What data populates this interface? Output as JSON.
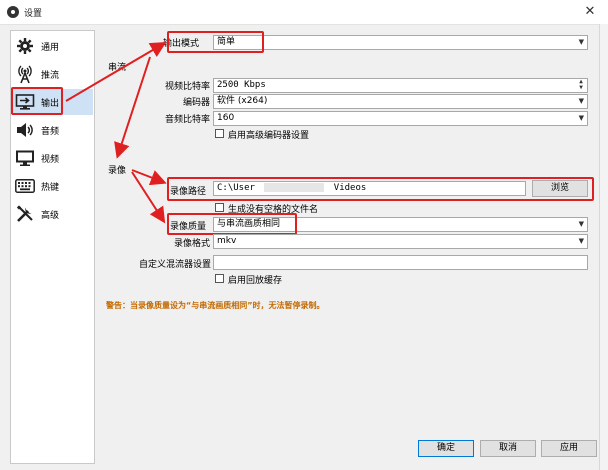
{
  "window": {
    "title": "设置",
    "close_symbol": "✕"
  },
  "sidebar": {
    "items": [
      {
        "label": "通用",
        "icon": "gear-icon"
      },
      {
        "label": "推流",
        "icon": "broadcast-antenna-icon"
      },
      {
        "label": "输出",
        "icon": "output-monitor-icon"
      },
      {
        "label": "音频",
        "icon": "speaker-icon"
      },
      {
        "label": "视频",
        "icon": "monitor-icon"
      },
      {
        "label": "热键",
        "icon": "keyboard-icon"
      },
      {
        "label": "高级",
        "icon": "tools-icon"
      }
    ],
    "active_index": 2
  },
  "output": {
    "mode_label": "输出模式",
    "mode_value": "简单",
    "streaming_section": "串流",
    "video_bitrate_label": "视频比特率",
    "video_bitrate_value": "2500 Kbps",
    "encoder_label": "编码器",
    "encoder_value": "软件 (x264)",
    "audio_bitrate_label": "音频比特率",
    "audio_bitrate_value": "160",
    "advanced_encoder_checkbox": "启用高级编码器设置",
    "recording_section": "录像",
    "recording_path_label": "录像路径",
    "recording_path_value_start": "C:\\User",
    "recording_path_value_end": "Videos",
    "browse_button": "浏览",
    "no_space_filename_checkbox": "生成没有空格的文件名",
    "recording_quality_label": "录像质量",
    "recording_quality_value": "与串流画质相同",
    "recording_format_label": "录像格式",
    "recording_format_value": "mkv",
    "custom_muxer_label": "自定义混流器设置",
    "custom_muxer_value": "",
    "replay_buffer_checkbox": "启用回放缓存",
    "warning": "警告：当录像质量设为“与串流画质相同”时，无法暂停录制。"
  },
  "buttons": {
    "ok": "确定",
    "cancel": "取消",
    "apply": "应用"
  },
  "colors": {
    "highlight_red": "#e02020",
    "warning": "#c46a00",
    "active_item": "#cfe1f5"
  }
}
